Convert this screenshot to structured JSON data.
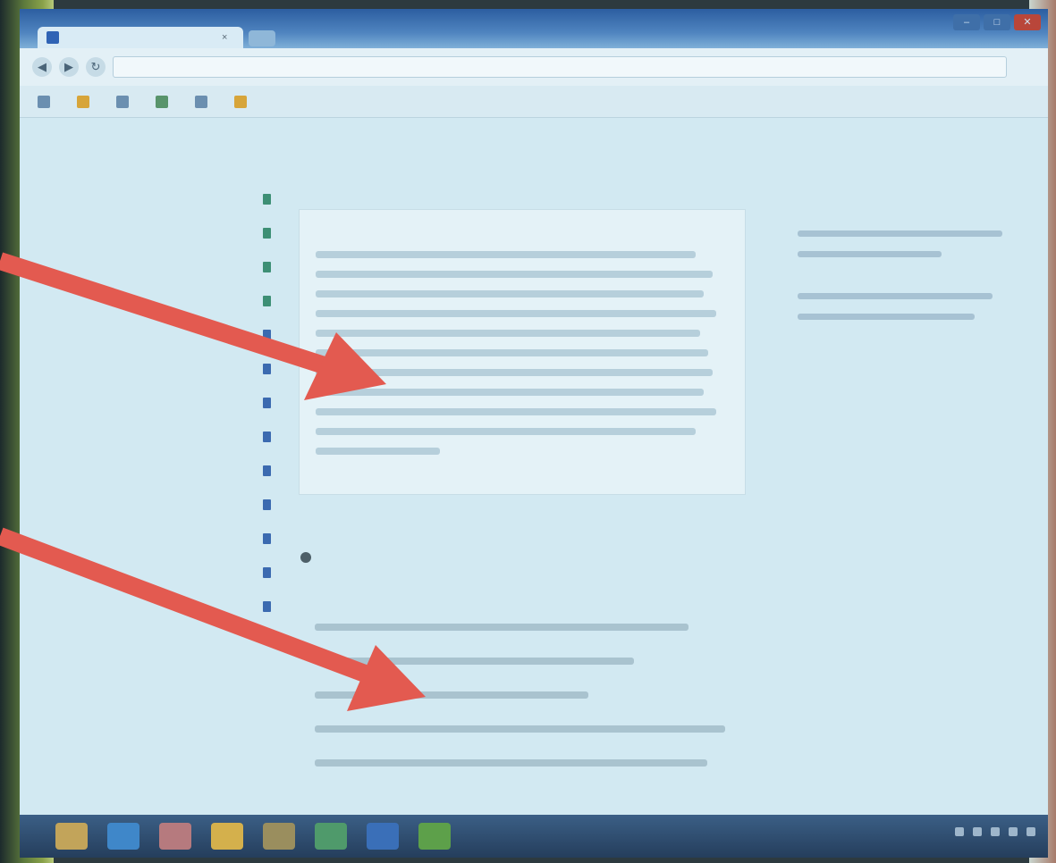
{
  "browser": {
    "tab_title": "",
    "tab_close": "×",
    "address": "",
    "nav": {
      "back": "◀",
      "forward": "▶",
      "refresh": "↻"
    },
    "window_controls": {
      "minimize": "–",
      "maximize": "□",
      "close": "✕"
    },
    "bookmarks": [
      {
        "label": "",
        "icon": "page-icon"
      },
      {
        "label": "",
        "icon": "page-icon"
      },
      {
        "label": "",
        "icon": "page-icon"
      },
      {
        "label": "",
        "icon": "page-icon"
      },
      {
        "label": "",
        "icon": "page-icon"
      },
      {
        "label": "",
        "icon": "page-icon"
      }
    ]
  },
  "sidebar": {
    "header": "",
    "section": "",
    "items": [
      {
        "label": ""
      },
      {
        "label": ""
      },
      {
        "label": ""
      },
      {
        "label": ""
      },
      {
        "label": ""
      },
      {
        "label": ""
      },
      {
        "label": ""
      },
      {
        "label": ""
      },
      {
        "label": ""
      },
      {
        "label": ""
      },
      {
        "label": ""
      },
      {
        "label": ""
      },
      {
        "label": ""
      }
    ]
  },
  "main": {
    "title": "",
    "subtitle": "",
    "card_greeting": "",
    "section_title": "",
    "section_subtitle": ""
  },
  "right": {
    "title": ""
  },
  "taskbar": {
    "apps": [
      "explorer-icon",
      "internet-explorer-icon",
      "media-icon",
      "folder-icon",
      "chrome-icon",
      "excel-icon",
      "lync-icon",
      "project-icon"
    ]
  },
  "colors": {
    "arrow": "#e35a50",
    "screen_background": "#cfe6ef",
    "taskbar": "#2b4766"
  }
}
